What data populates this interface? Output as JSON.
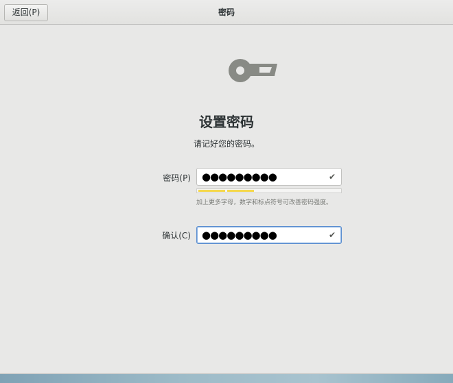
{
  "header": {
    "back_label": "返回(P)",
    "title": "密码"
  },
  "main": {
    "icon": "key-icon",
    "title": "设置密码",
    "subtitle": "请记好您的密码。"
  },
  "form": {
    "password_label": "密码(P)",
    "password_value": "●●●●●●●●●",
    "confirm_label": "确认(C)",
    "confirm_value": "●●●●●●●●●",
    "strength": {
      "segments_total": 5,
      "segments_filled": 2
    },
    "hint": "加上更多字母，数字和标点符号可改善密码强度。",
    "valid_icon": "checkmark-icon"
  },
  "colors": {
    "strength_fill": "#f5d84c",
    "focus_border": "#5b8ed0"
  }
}
